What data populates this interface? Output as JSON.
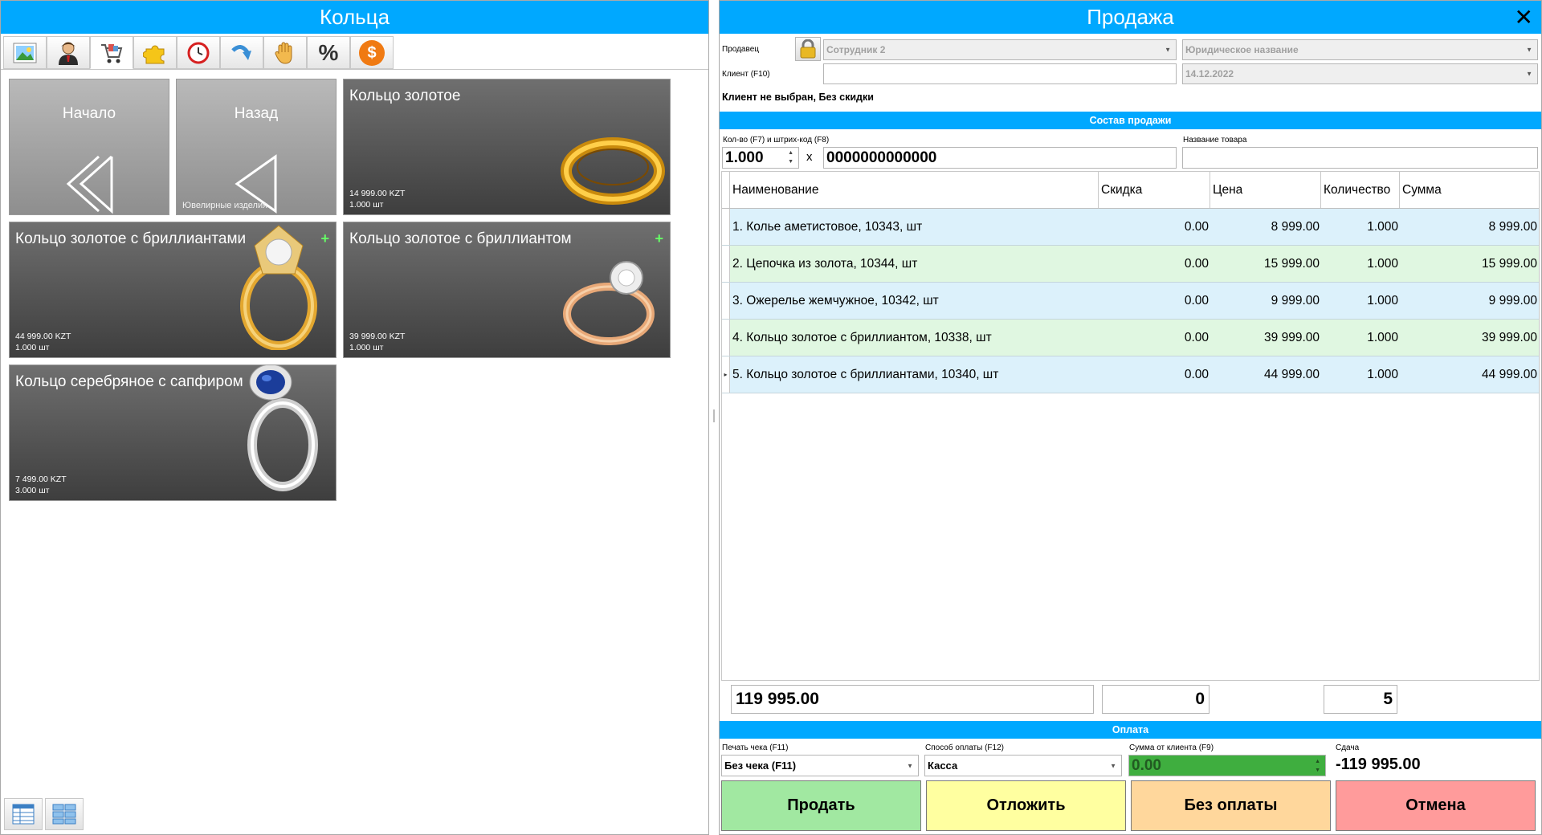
{
  "left": {
    "title": "Кольца",
    "toolbar": [
      {
        "name": "picture-icon"
      },
      {
        "name": "user-icon"
      },
      {
        "name": "cart-icon"
      },
      {
        "name": "puzzle-icon"
      },
      {
        "name": "clock-icon"
      },
      {
        "name": "redo-arrow-icon"
      },
      {
        "name": "hand-icon"
      },
      {
        "name": "percent-icon",
        "text": "%"
      },
      {
        "name": "dollar-coin-icon",
        "text": "$"
      }
    ],
    "nav_tiles": {
      "home": {
        "label": "Начало"
      },
      "back": {
        "label": "Назад",
        "sub": "Ювелирные изделия"
      }
    },
    "products": [
      {
        "name": "Кольцо золотое",
        "price": "14 999.00 KZT",
        "qty": "1.000 шт",
        "has_plus": false,
        "image": "gold-band-ring-image"
      },
      {
        "name": "Кольцо золотое с бриллиантами",
        "price": "44 999.00 KZT",
        "qty": "1.000 шт",
        "has_plus": true,
        "plus": "+",
        "image": "gold-diamond-halo-ring-image"
      },
      {
        "name": "Кольцо золотое с бриллиантом",
        "price": "39 999.00 KZT",
        "qty": "1.000 шт",
        "has_plus": true,
        "plus": "+",
        "image": "rose-gold-diamond-ring-image"
      },
      {
        "name": "Кольцо серебряное с сапфиром",
        "price": "7 499.00 KZT",
        "qty": "3.000 шт",
        "has_plus": false,
        "image": "silver-sapphire-ring-image"
      }
    ],
    "view_buttons": [
      {
        "name": "table-view-icon"
      },
      {
        "name": "tile-view-icon"
      }
    ]
  },
  "right": {
    "title": "Продажа",
    "close": "✕",
    "seller_label": "Продавец",
    "seller_value": "Сотрудник 2",
    "legal_name_value": "Юридическое название",
    "client_label": "Клиент (F10)",
    "client_value": "",
    "date_value": "14.12.2022",
    "client_status": "Клиент не выбран, Без скидки",
    "sale_section": "Состав продажи",
    "qty_label": "Кол-во (F7) и штрих-код (F8)",
    "qty_value": "1.000",
    "times": "x",
    "barcode_value": "0000000000000",
    "product_name_label": "Название товара",
    "product_name_value": "",
    "columns": [
      "Наименование",
      "Скидка",
      "Цена",
      "Количество",
      "Сумма"
    ],
    "rows": [
      {
        "name": "1. Колье аметистовое, 10343, шт",
        "discount": "0.00",
        "price": "8 999.00",
        "qty": "1.000",
        "sum": "8 999.00"
      },
      {
        "name": "2. Цепочка из золота, 10344, шт",
        "discount": "0.00",
        "price": "15 999.00",
        "qty": "1.000",
        "sum": "15 999.00"
      },
      {
        "name": "3. Ожерелье жемчужное, 10342, шт",
        "discount": "0.00",
        "price": "9 999.00",
        "qty": "1.000",
        "sum": "9 999.00"
      },
      {
        "name": "4. Кольцо золотое с бриллиантом, 10338, шт",
        "discount": "0.00",
        "price": "39 999.00",
        "qty": "1.000",
        "sum": "39 999.00"
      },
      {
        "name": "5. Кольцо золотое с бриллиантами, 10340, шт",
        "discount": "0.00",
        "price": "44 999.00",
        "qty": "1.000",
        "sum": "44 999.00"
      }
    ],
    "current_row_marker": "▸",
    "totals": {
      "sum": "119 995.00",
      "discount": "0",
      "qty": "5"
    },
    "payment_section": "Оплата",
    "receipt_label": "Печать чека (F11)",
    "receipt_value": "Без чека (F11)",
    "payment_method_label": "Способ оплаты (F12)",
    "payment_method_value": "Касса",
    "client_amount_label": "Сумма от клиента (F9)",
    "client_amount_value": "0.00",
    "change_label": "Сдача",
    "change_value": "-119 995.00",
    "buttons": {
      "sell": "Продать",
      "postpone": "Отложить",
      "no_payment": "Без оплаты",
      "cancel": "Отмена"
    },
    "colors": {
      "accent": "#00a8ff",
      "sell": "#a1e8a1",
      "postpone": "#ffffa0",
      "no_payment": "#ffd79c",
      "cancel": "#ff9b9b",
      "amount_field": "#3fae3f"
    }
  }
}
